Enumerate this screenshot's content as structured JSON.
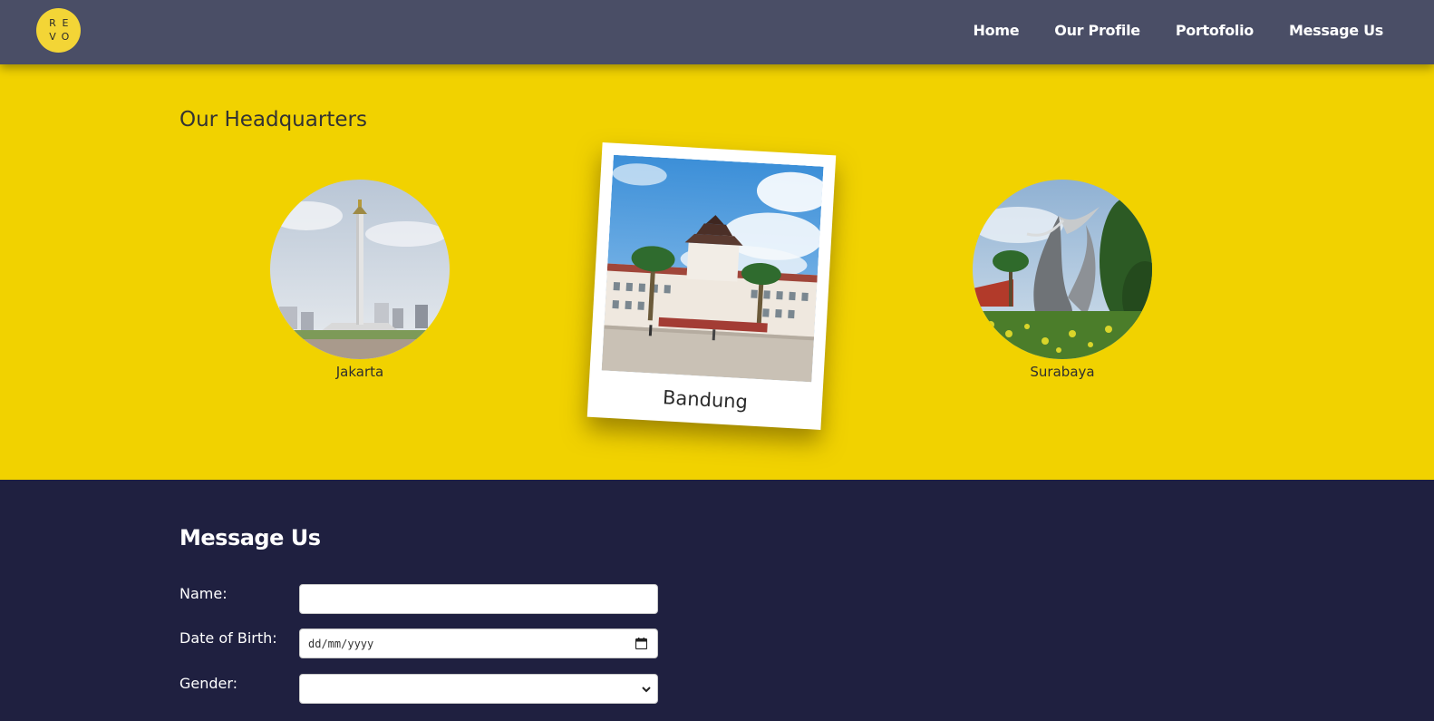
{
  "navbar": {
    "logo_letters": [
      "R",
      "E",
      "V",
      "O"
    ],
    "links": [
      "Home",
      "Our Profile",
      "Portofolio",
      "Message Us"
    ]
  },
  "headquarters": {
    "title": "Our Headquarters",
    "cities": [
      {
        "name": "Jakarta",
        "icon": "monas-monument-photo"
      },
      {
        "name": "Bandung",
        "icon": "gedung-sate-photo",
        "featured": true
      },
      {
        "name": "Surabaya",
        "icon": "sura-buaya-statue-photo"
      }
    ]
  },
  "message": {
    "title": "Message Us",
    "fields": [
      {
        "label": "Name:",
        "type": "text",
        "value": ""
      },
      {
        "label": "Date of Birth:",
        "type": "date",
        "placeholder": "dd/mm/yyyy"
      },
      {
        "label": "Gender:",
        "type": "select",
        "value": ""
      }
    ]
  },
  "colors": {
    "navbar": "#4a4e66",
    "accent_yellow": "#f1d200",
    "dark_section": "#1f2040",
    "logo": "#f3d536"
  }
}
